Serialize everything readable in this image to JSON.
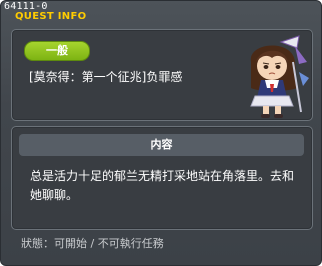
{
  "window": {
    "quest_id": "64111-0",
    "title": "QUEST INFO"
  },
  "quest": {
    "category_badge": "一般",
    "name": "[莫奈得：第一个征兆]负罪感"
  },
  "content": {
    "header": "内容",
    "text": "总是活力十足的郁兰无精打采地站在角落里。去和她聊聊。"
  },
  "status": "狀態：可開始 / 不可執行任務",
  "colors": {
    "title": "#ffcc00",
    "badge": "#8fc21f",
    "background": "#41464c"
  },
  "icons": {
    "npc": "npc-portrait-icon"
  }
}
